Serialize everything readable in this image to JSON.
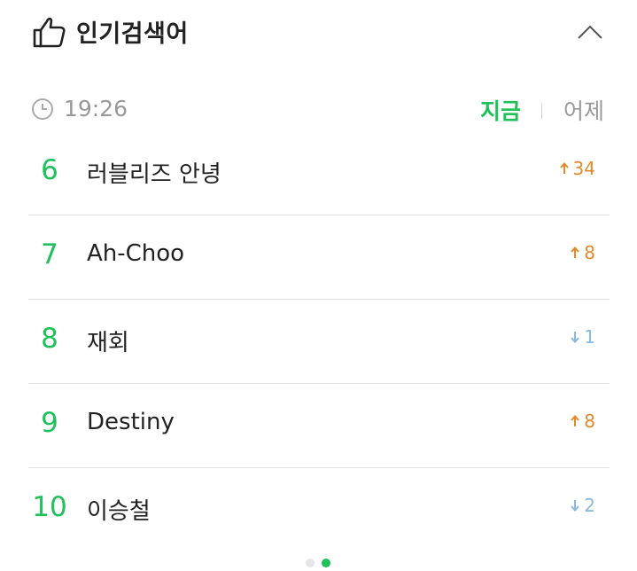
{
  "header": {
    "title": "인기검색어",
    "icon": "thumbs-up-icon",
    "collapse_icon": "chevron-up-icon"
  },
  "timebar": {
    "time": "19:26",
    "tab_now": "지금",
    "tab_yesterday": "어제"
  },
  "colors": {
    "accent": "#1ec15a",
    "up": "#e28a2b",
    "down": "#8ab8de"
  },
  "items": [
    {
      "rank": "6",
      "keyword": "러블리즈 안녕",
      "direction": "up",
      "change": "34"
    },
    {
      "rank": "7",
      "keyword": "Ah-Choo",
      "direction": "up",
      "change": "8"
    },
    {
      "rank": "8",
      "keyword": "재회",
      "direction": "down",
      "change": "1"
    },
    {
      "rank": "9",
      "keyword": "Destiny",
      "direction": "up",
      "change": "8"
    },
    {
      "rank": "10",
      "keyword": "이승철",
      "direction": "down",
      "change": "2"
    }
  ],
  "pager": {
    "pages": 2,
    "current": 2
  }
}
